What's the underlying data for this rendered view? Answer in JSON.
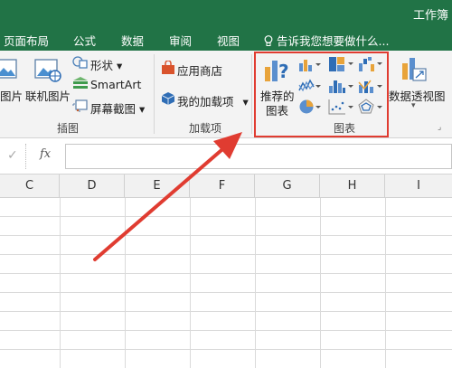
{
  "window": {
    "title": "工作簿"
  },
  "tabs": [
    "页面布局",
    "公式",
    "数据",
    "审阅",
    "视图"
  ],
  "tell_me": "告诉我您想要做什么...",
  "ribbon": {
    "illustrations": {
      "picture_label": "图片",
      "online_picture_label": "联机图片",
      "shapes_label": "形状",
      "smartart_label": "SmartArt",
      "screenshot_label": "屏幕截图",
      "group_label": "插图"
    },
    "addins": {
      "store_label": "应用商店",
      "my_addins_label": "我的加载项",
      "group_label": "加载项"
    },
    "charts": {
      "recommended_line1": "推荐的",
      "recommended_line2": "图表",
      "group_label": "图表",
      "highlight_color": "#e03c31"
    },
    "pivot_chart_label": "数据透视图"
  },
  "formula_bar": {
    "check": "✓",
    "fx": "fx",
    "value": ""
  },
  "columns": [
    "C",
    "D",
    "E",
    "F",
    "G",
    "H",
    "I"
  ],
  "annotation": {
    "arrow_color": "#e03c31"
  }
}
